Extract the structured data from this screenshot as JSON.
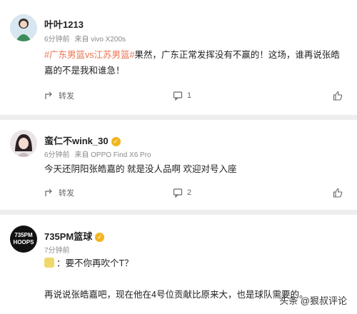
{
  "posts": [
    {
      "username": "叶叶1213",
      "time": "6分钟前",
      "device": "来自 vivo X200s",
      "text_tag1": "#广东男篮vs江苏男篮#",
      "text_main": "果然，广东正常发挥没有不赢的！这场，谁再说张皓嘉的不是我和谁急！",
      "forward_label": "转发",
      "comment_count": "1",
      "like_count": ""
    },
    {
      "username": "蛮仁不wink_30",
      "time": "6分钟前",
      "device": "来自 OPPO Find X6 Pro",
      "text_main": "今天还阴阳张皓嘉的 就是没人品啊 欢迎对号入座",
      "forward_label": "转发",
      "comment_count": "2",
      "like_count": ""
    },
    {
      "username": "735PM篮球",
      "avatar_text_line1": "735PM",
      "avatar_text_line2": "HOOPS",
      "time": "7分钟前",
      "line1": "：要不你再吹个T？",
      "line2": "再说说张皓嘉吧，现在他在4号位贡献比原来大，也是球队需要的。"
    }
  ],
  "watermark": "头条 @狠叔评论",
  "colors": {
    "tag": "#eb7350",
    "badge": "#f2b51c"
  }
}
